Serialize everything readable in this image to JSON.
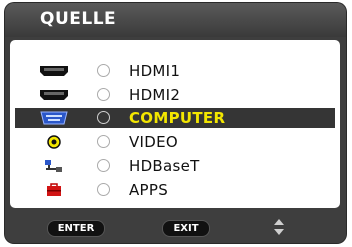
{
  "window": {
    "title": "QUELLE"
  },
  "sources": [
    {
      "label": "HDMI1",
      "icon": "hdmi-icon",
      "selected": false
    },
    {
      "label": "HDMI2",
      "icon": "hdmi-icon",
      "selected": false
    },
    {
      "label": "COMPUTER",
      "icon": "vga-icon",
      "selected": true
    },
    {
      "label": "VIDEO",
      "icon": "video-icon",
      "selected": false
    },
    {
      "label": "HDBaseT",
      "icon": "network-icon",
      "selected": false
    },
    {
      "label": "APPS",
      "icon": "apps-icon",
      "selected": false
    }
  ],
  "footer": {
    "enter_label": "ENTER",
    "exit_label": "EXIT",
    "navigate_icon": "up-down-arrows-icon"
  },
  "colors": {
    "selected_text": "#f3e600",
    "selected_row": "#353535",
    "background": "#3e3e3e"
  }
}
